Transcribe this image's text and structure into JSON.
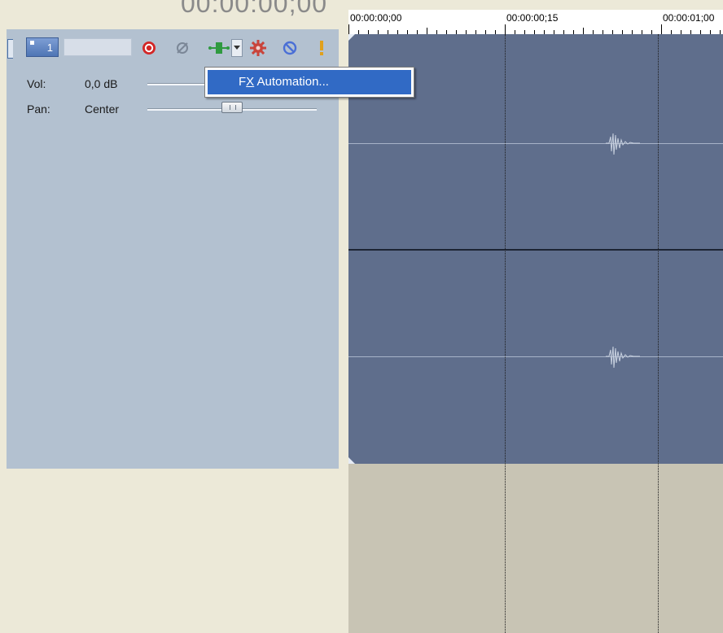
{
  "timecode": "00:00:00;00",
  "ruler": {
    "labels": [
      "00:00:00;00",
      "00:00:00;15",
      "00:00:01;00"
    ]
  },
  "track": {
    "number": "1",
    "name_value": "",
    "vol_label": "Vol:",
    "vol_value": "0,0 dB",
    "pan_label": "Pan:",
    "pan_value": "Center",
    "buttons": [
      {
        "icon": "arm-record-icon"
      },
      {
        "icon": "invert-phase-icon"
      },
      {
        "icon": "automation-mode-icon"
      },
      {
        "icon": "automation-dropdown-icon"
      },
      {
        "icon": "track-fx-icon"
      },
      {
        "icon": "mute-icon"
      },
      {
        "icon": "solo-icon"
      }
    ]
  },
  "menu": {
    "items": [
      {
        "label_prefix": "F",
        "label_accel": "X",
        "label_rest": " Automation..."
      }
    ]
  },
  "colors": {
    "track_header": "#b3c1d0",
    "event_bg": "#5f6e8c",
    "menu_highlight": "#316ac5",
    "empty_timeline": "#c8c4b4"
  }
}
